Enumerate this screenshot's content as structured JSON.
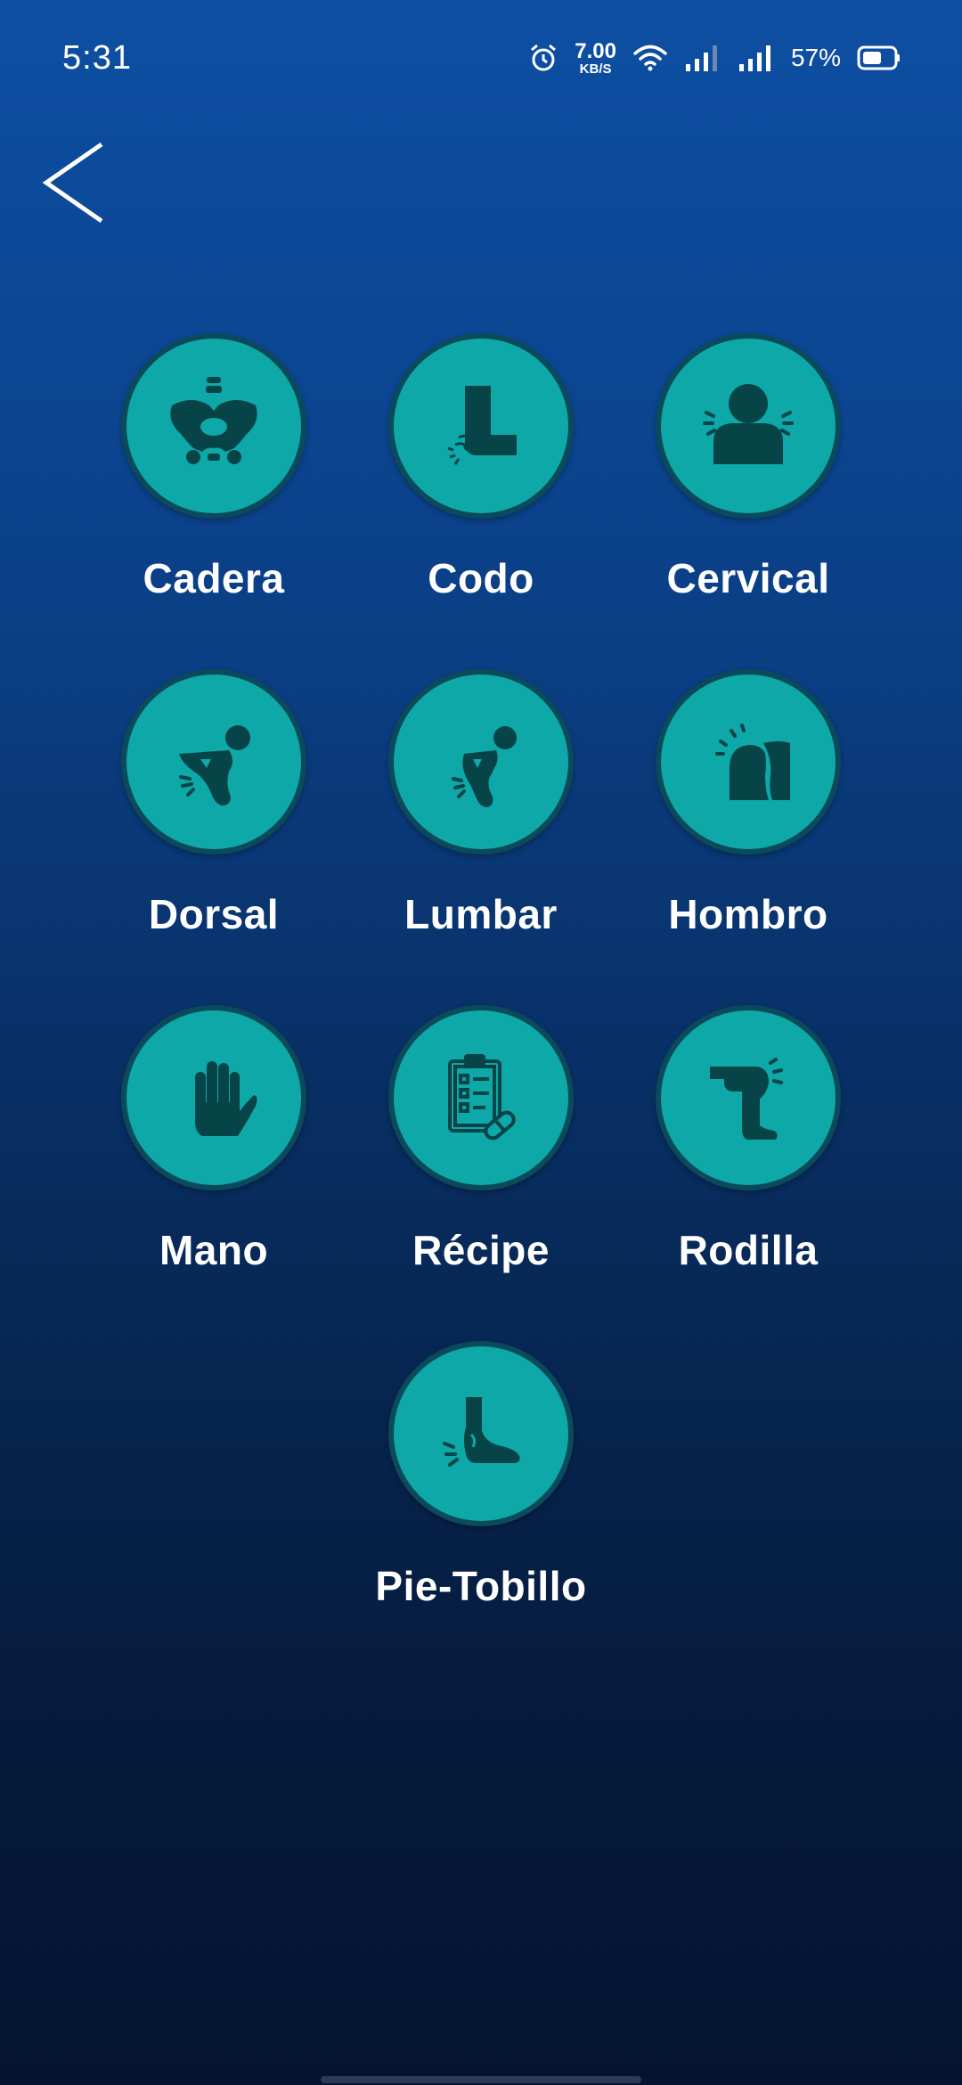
{
  "status_bar": {
    "time": "5:31",
    "speed_value": "7.00",
    "speed_unit": "KB/S",
    "battery": "57%"
  },
  "colors": {
    "tile_fill": "#0ea8a8",
    "tile_border": "#0a4a5a",
    "icon_color": "#064448"
  },
  "menu": {
    "items": [
      {
        "label": "Cadera",
        "icon": "pelvis-icon"
      },
      {
        "label": "Codo",
        "icon": "elbow-icon"
      },
      {
        "label": "Cervical",
        "icon": "neck-icon"
      },
      {
        "label": "Dorsal",
        "icon": "upper-back-icon"
      },
      {
        "label": "Lumbar",
        "icon": "lower-back-icon"
      },
      {
        "label": "Hombro",
        "icon": "shoulder-icon"
      },
      {
        "label": "Mano",
        "icon": "hand-icon"
      },
      {
        "label": "Récipe",
        "icon": "prescription-clipboard-icon"
      },
      {
        "label": "Rodilla",
        "icon": "knee-icon"
      },
      {
        "label": "Pie-Tobillo",
        "icon": "foot-ankle-icon"
      }
    ]
  }
}
